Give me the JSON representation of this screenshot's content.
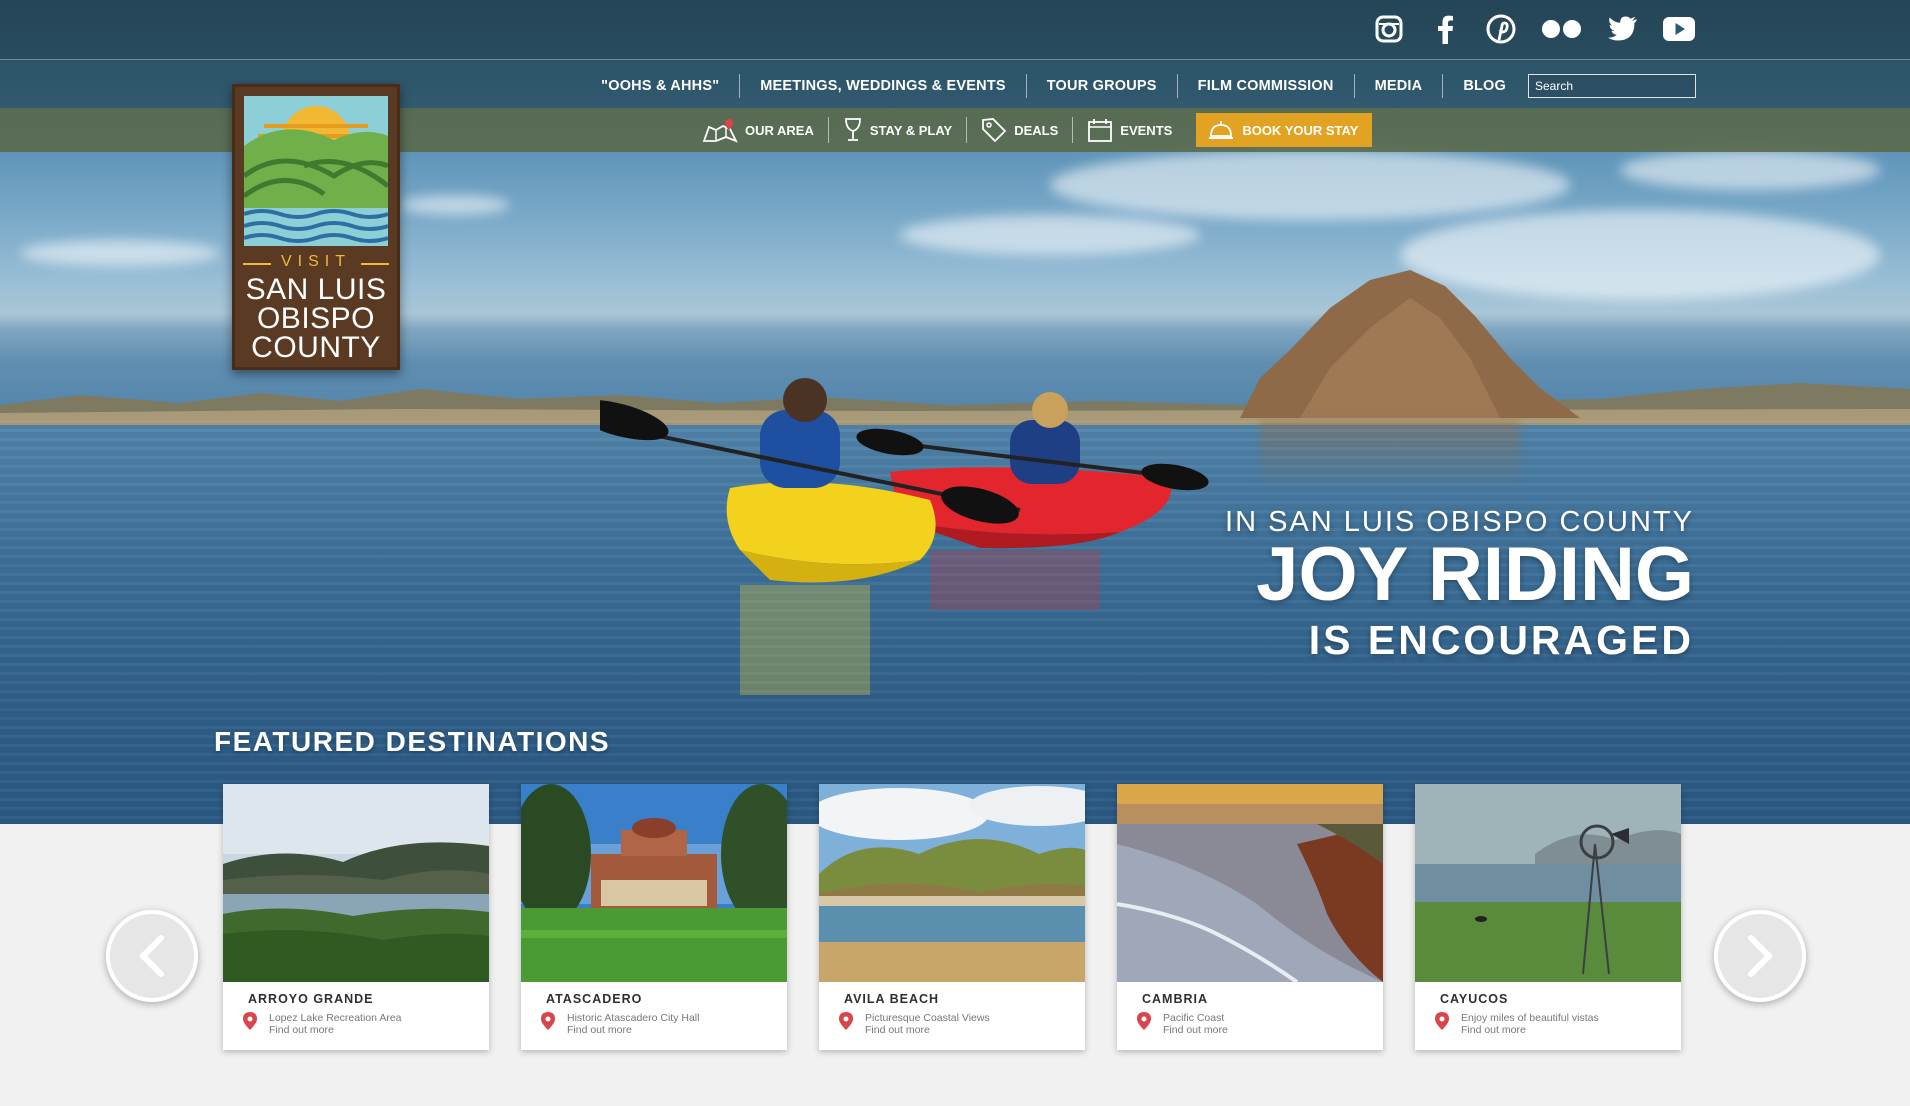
{
  "social": [
    {
      "name": "instagram-icon"
    },
    {
      "name": "facebook-icon"
    },
    {
      "name": "pinterest-icon"
    },
    {
      "name": "flickr-icon"
    },
    {
      "name": "twitter-icon"
    },
    {
      "name": "youtube-icon"
    }
  ],
  "nav_primary": {
    "items": [
      "\"OOHS & AHHS\"",
      "MEETINGS, WEDDINGS & EVENTS",
      "TOUR GROUPS",
      "FILM COMMISSION",
      "MEDIA",
      "BLOG"
    ],
    "search_placeholder": "Search"
  },
  "nav_secondary": {
    "items": [
      {
        "label": "OUR AREA",
        "icon": "map-icon"
      },
      {
        "label": "STAY & PLAY",
        "icon": "wine-glass-icon"
      },
      {
        "label": "DEALS",
        "icon": "tag-icon"
      },
      {
        "label": "EVENTS",
        "icon": "calendar-icon"
      }
    ],
    "book_label": "BOOK YOUR STAY",
    "book_color": "#e3a322"
  },
  "logo": {
    "visit": "VISIT",
    "name": "SAN LUIS\nOBISPO\nCOUNTY"
  },
  "hero": {
    "line1": "IN SAN LUIS OBISPO COUNTY",
    "line2": "JOY RIDING",
    "line3": "IS ENCOURAGED"
  },
  "featured": {
    "heading": "FEATURED DESTINATIONS",
    "cards": [
      {
        "title": "ARROYO GRANDE",
        "subtitle": "Lopez Lake Recreation Area",
        "link": "Find out more"
      },
      {
        "title": "ATASCADERO",
        "subtitle": "Historic Atascadero City Hall",
        "link": "Find out more"
      },
      {
        "title": "AVILA BEACH",
        "subtitle": "Picturesque Coastal Views",
        "link": "Find out more"
      },
      {
        "title": "CAMBRIA",
        "subtitle": "Pacific Coast",
        "link": "Find out more"
      },
      {
        "title": "CAYUCOS",
        "subtitle": "Enjoy miles of beautiful vistas",
        "link": "Find out more"
      }
    ]
  },
  "colors": {
    "accent": "#e3a322",
    "logo_brown": "#5a3a22",
    "pin_red": "#d9454a"
  }
}
